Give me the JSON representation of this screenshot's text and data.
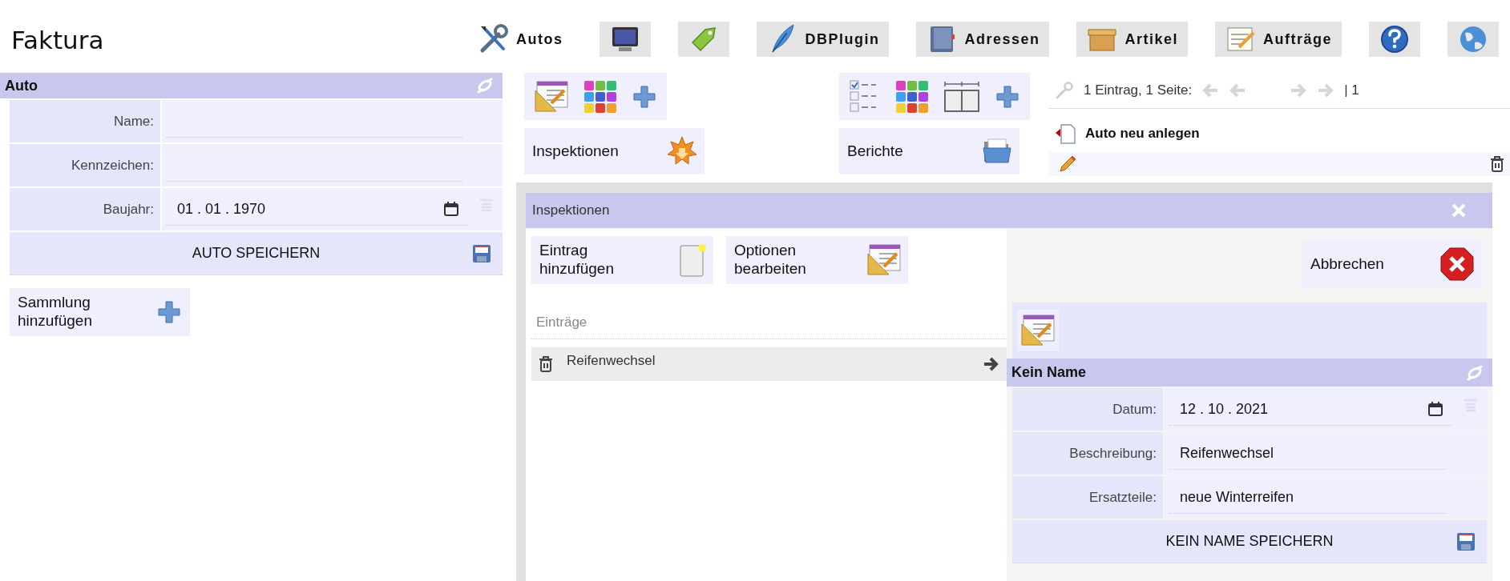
{
  "app_title": "Faktura",
  "nav": [
    {
      "label": "Autos",
      "selected": true
    },
    {
      "selected": false
    },
    {
      "selected": false
    },
    {
      "label": "DBPlugin",
      "selected": false
    },
    {
      "label": "Adressen",
      "selected": false
    },
    {
      "label": "Artikel",
      "selected": false
    },
    {
      "label": "Aufträge",
      "selected": false
    },
    {
      "selected": false
    },
    {
      "selected": false
    }
  ],
  "auto_form": {
    "title": "Auto",
    "fields": [
      {
        "label": "Name:",
        "kind": "text"
      },
      {
        "label": "Kennzeichen:",
        "kind": "text"
      },
      {
        "label": "Baujahr:",
        "value": "01 . 01 . 1970",
        "kind": "date"
      }
    ],
    "save_button": "AUTO SPEICHERN"
  },
  "collection_button": "Sammlung hinzufügen",
  "inspections_button": "Inspektionen",
  "reports_button": "Berichte",
  "list": {
    "pagination": "1 Eintrag, 1 Seite:",
    "page": "| 1",
    "new_button": "Auto neu anlegen"
  },
  "dialog": {
    "title": "Inspektionen",
    "add_button": "Eintrag hinzufügen",
    "options_button": "Optionen bearbeiten",
    "entries_label": "Einträge",
    "entries": [
      {
        "label": "Reifenwechsel"
      }
    ],
    "cancel_button": "Abbrechen",
    "record": {
      "title": "Kein Name",
      "fields": [
        {
          "label": "Datum:",
          "value": "12 . 10 . 2021",
          "kind": "date"
        },
        {
          "label": "Beschreibung:",
          "value": "Reifenwechsel",
          "kind": "text"
        },
        {
          "label": "Ersatzteile:",
          "value": "neue Winterreifen",
          "kind": "text"
        }
      ],
      "save_button": "KEIN NAME SPEICHERN"
    }
  }
}
